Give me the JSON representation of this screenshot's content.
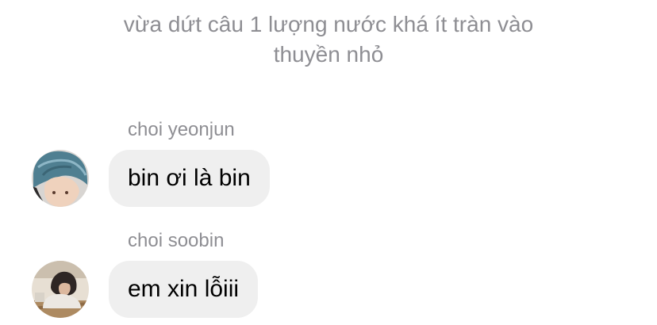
{
  "system_message": {
    "line1": "vừa dứt câu 1 lượng nước khá ít tràn vào",
    "line2": "thuyền nhỏ"
  },
  "messages": [
    {
      "sender": "choi yeonjun",
      "text": "bin ơi là bin",
      "avatar_icon": "user-avatar-blue-hair"
    },
    {
      "sender": "choi soobin",
      "text": "em xin lỗiii",
      "avatar_icon": "user-avatar-photo"
    }
  ],
  "colors": {
    "meta_text": "#8e8e93",
    "bubble_background": "#efefef",
    "message_text": "#000000"
  }
}
